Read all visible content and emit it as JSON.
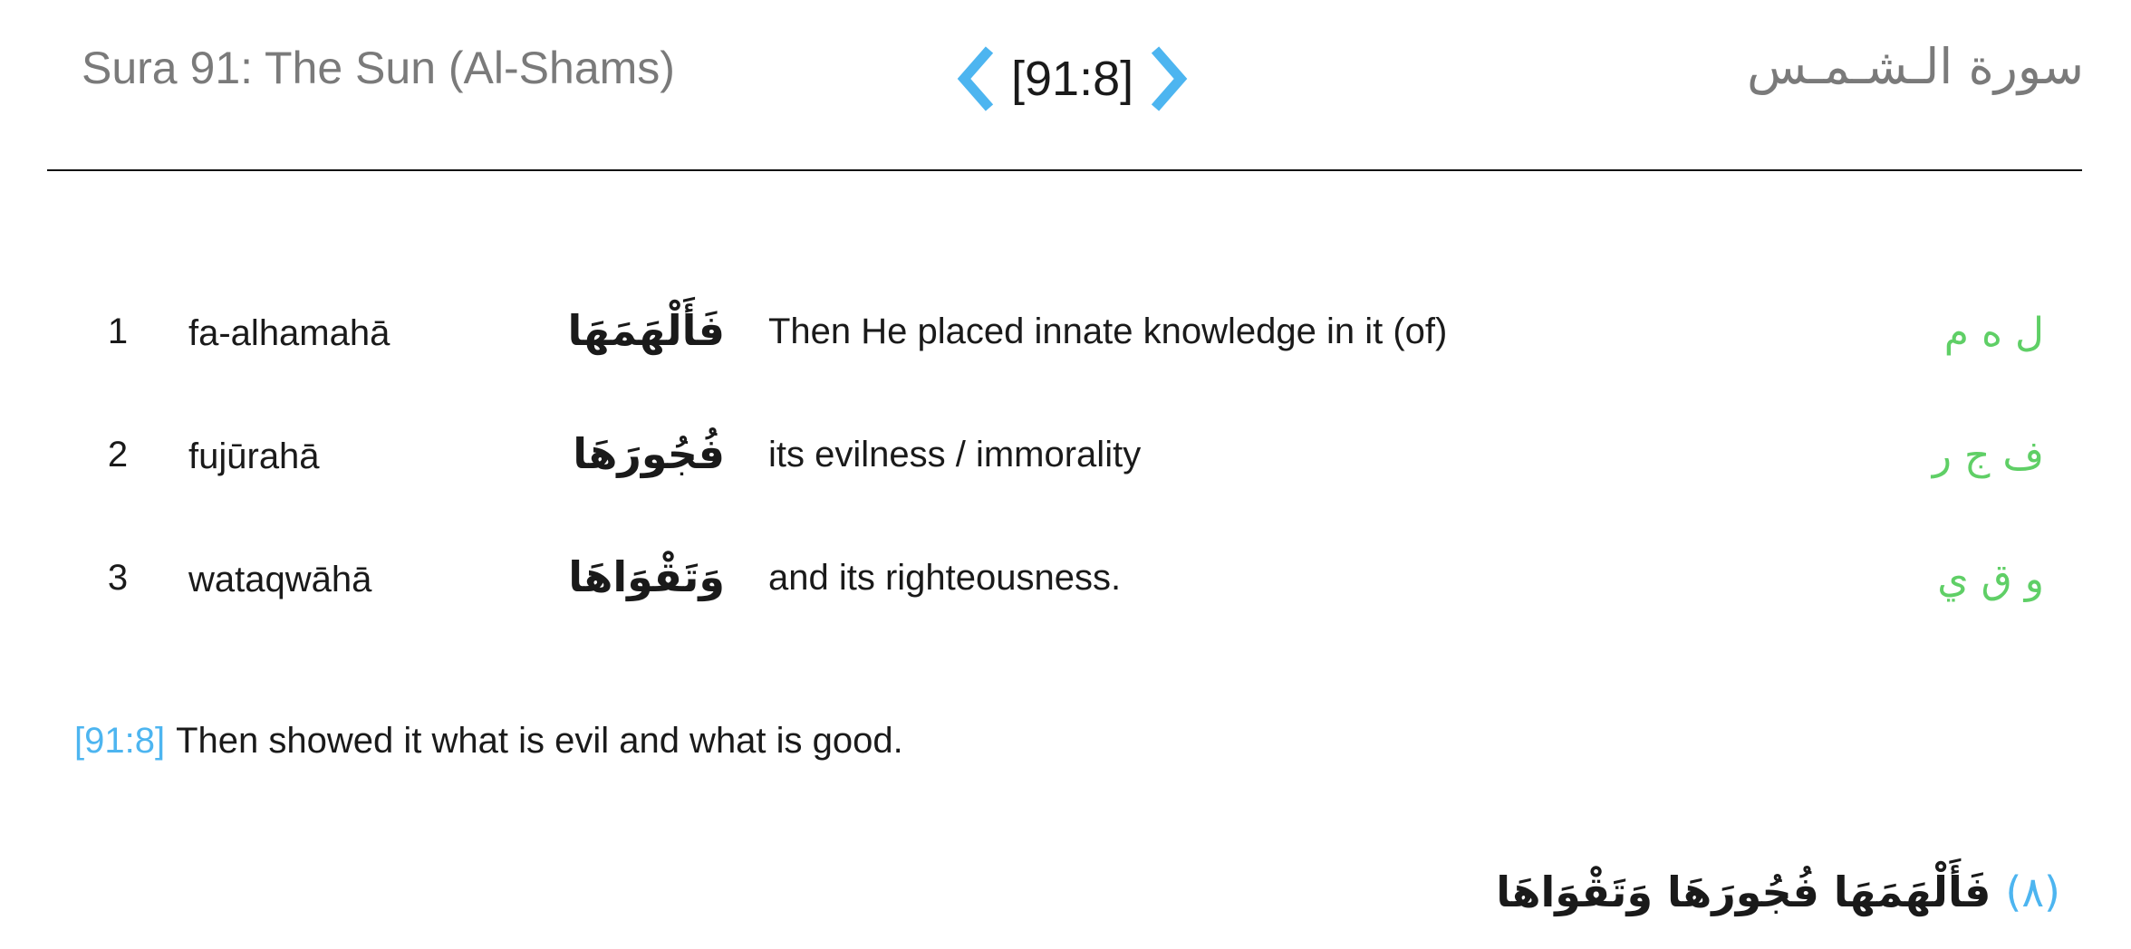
{
  "header": {
    "sura_title": "Sura 91: The Sun (Al-Shams)",
    "verse_ref": "[91:8]",
    "sura_arabic": "سورة الـشـمـس",
    "nav_prev_icon": "chevron-left-icon",
    "nav_next_icon": "chevron-right-icon",
    "accent_color": "#4db5f0"
  },
  "words": [
    {
      "num": "1",
      "translit": "fa-alhamahā",
      "arabic": "فَأَلْهَمَهَا",
      "meaning": "Then He placed innate knowledge in it (of)",
      "root": "ل ه م"
    },
    {
      "num": "2",
      "translit": "fujūrahā",
      "arabic": "فُجُورَهَا",
      "meaning": "its evilness / immorality",
      "root": "ف ج ر"
    },
    {
      "num": "3",
      "translit": "wataqwāhā",
      "arabic": "وَتَقْوَاهَا",
      "meaning": "and its righteousness.",
      "root": "و ق ي"
    }
  ],
  "root_color": "#5fcf66",
  "translation": {
    "ref": "[91:8]",
    "text": "Then showed it what is evil and what is good."
  },
  "verse_arabic": {
    "marker": "(٨)",
    "text": "فَأَلْهَمَهَا فُجُورَهَا وَتَقْوَاهَا"
  }
}
